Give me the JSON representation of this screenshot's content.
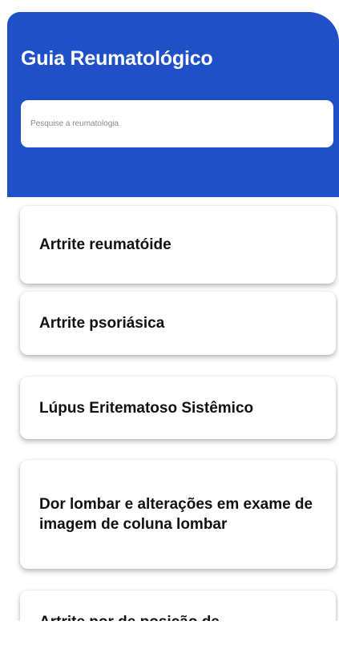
{
  "header": {
    "title": "Guia Reumatológico",
    "search_placeholder": "Pesquise a reumatologia",
    "search_value": ""
  },
  "topics": [
    {
      "label": "Artrite reumatóide"
    },
    {
      "label": "Artrite psoriásica"
    },
    {
      "label": "Lúpus Eritematoso Sistêmico"
    },
    {
      "label": "Dor lombar e alterações em exame de imagem de coluna lombar"
    },
    {
      "label": "Artrite por de posição de"
    }
  ],
  "colors": {
    "header_bg": "#2050c8",
    "card_bg": "#ffffff",
    "text": "#111111"
  }
}
